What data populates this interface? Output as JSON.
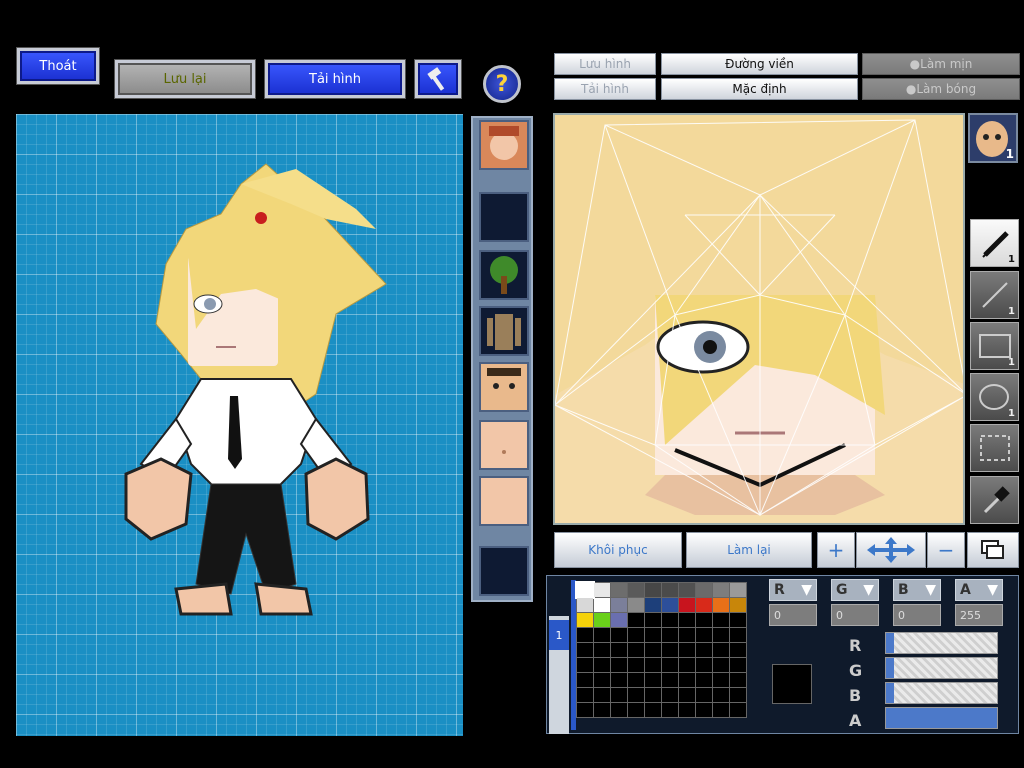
{
  "toolbar": {
    "exit_label": "Thoát",
    "save_label": "Lưu lại",
    "reload_label": "Tải hình"
  },
  "help_glyph": "?",
  "editor_toolbar": {
    "save_image": "Lưu hình",
    "outline": "Đường viền",
    "smooth": "Làm mịn",
    "load_image": "Tải hình",
    "default": "Mặc định",
    "gloss": "Làm bóng"
  },
  "face_thumb_count": "1",
  "tools": [
    {
      "name": "pen-tool",
      "count": "1"
    },
    {
      "name": "line-tool",
      "count": "1"
    },
    {
      "name": "rectangle-tool",
      "count": "1"
    },
    {
      "name": "ellipse-tool",
      "count": "1"
    },
    {
      "name": "select-tool",
      "count": ""
    },
    {
      "name": "eyedropper-tool",
      "count": ""
    }
  ],
  "bottom_buttons": {
    "restore": "Khôi phục",
    "redo": "Làm lại"
  },
  "layer_tab": "1",
  "channels": {
    "r_label": "R",
    "g_label": "G",
    "b_label": "B",
    "a_label": "A",
    "r_value": "0",
    "g_value": "0",
    "b_value": "0",
    "a_value": "255"
  },
  "sliders": {
    "r": 0,
    "g": 0,
    "b": 0,
    "a": 255
  },
  "palette_colors": [
    "#ffffff",
    "#e8e8e8",
    "#6d6d6d",
    "#5a5a5a",
    "#474747",
    "#4b4b4b",
    "#515151",
    "#6a6a6a",
    "#7d7d7d",
    "#9a9a9a",
    "#d8d8d8",
    "#ffffff",
    "#7b7f9a",
    "#8a8a8a",
    "#1d3f7a",
    "#2d4f9a",
    "#c8141e",
    "#d82a1a",
    "#e87018",
    "#c8860a",
    "#f5d20a",
    "#6ad01a",
    "#6a6fb0"
  ]
}
